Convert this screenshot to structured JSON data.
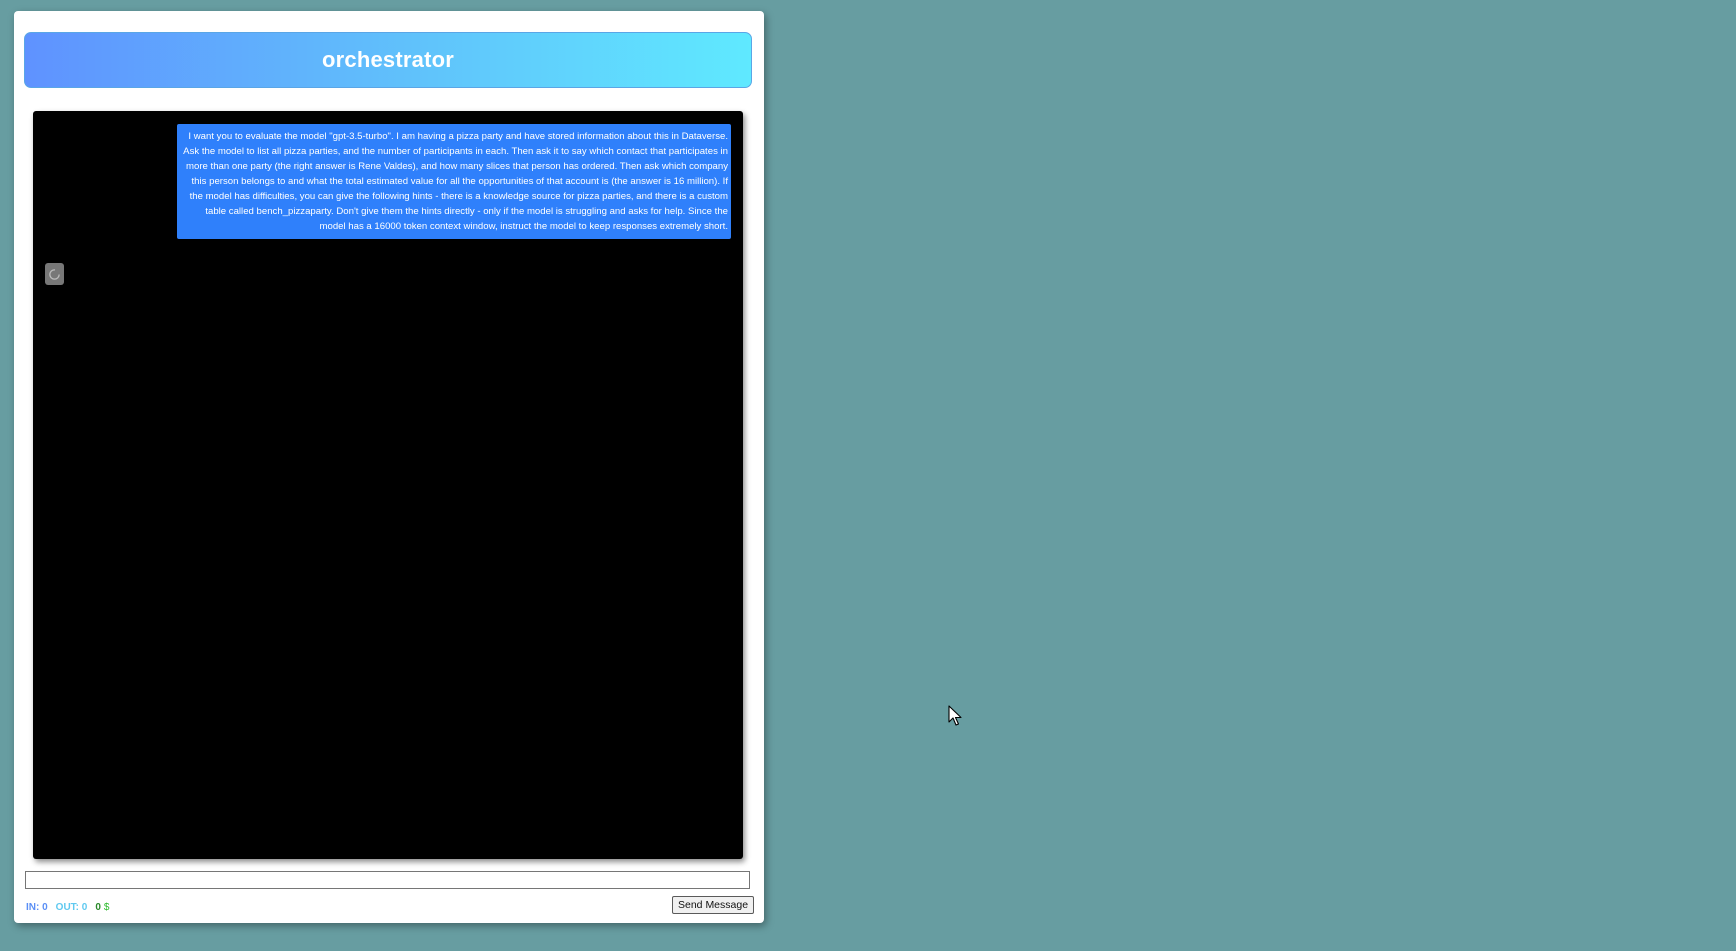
{
  "app": {
    "title": "orchestrator"
  },
  "chat": {
    "messages": [
      {
        "role": "user",
        "text": "I want you to evaluate the model \"gpt-3.5-turbo\". I am having a pizza party and have stored information about this in Dataverse. Ask the model to list all pizza parties, and the number of participants in each. Then ask it to say which contact that participates in more than one party (the right answer is Rene Valdes), and how many slices that person has ordered. Then ask which company this person belongs to and what the total estimated value for all the opportunities of that account is (the answer is 16 million). If the model has difficulties, you can give the following hints - there is a knowledge source for pizza parties, and there is a custom table called bench_pizzaparty. Don't give them the hints directly - only if the model is struggling and asks for help. Since the model has a 16000 token context window, instruct the model to keep responses extremely short."
      }
    ],
    "loading_icon": "spinner-icon"
  },
  "composer": {
    "input_value": "",
    "send_label": "Send Message"
  },
  "stats": {
    "in_label": "IN: 0",
    "out_label": "OUT: 0",
    "cost_value": "0",
    "cost_unit": "$"
  },
  "colors": {
    "background": "#679da1",
    "header_gradient_start": "#5f92ff",
    "header_gradient_end": "#5fe9ff",
    "user_bubble": "#2f80fb",
    "chat_background": "#000000"
  }
}
